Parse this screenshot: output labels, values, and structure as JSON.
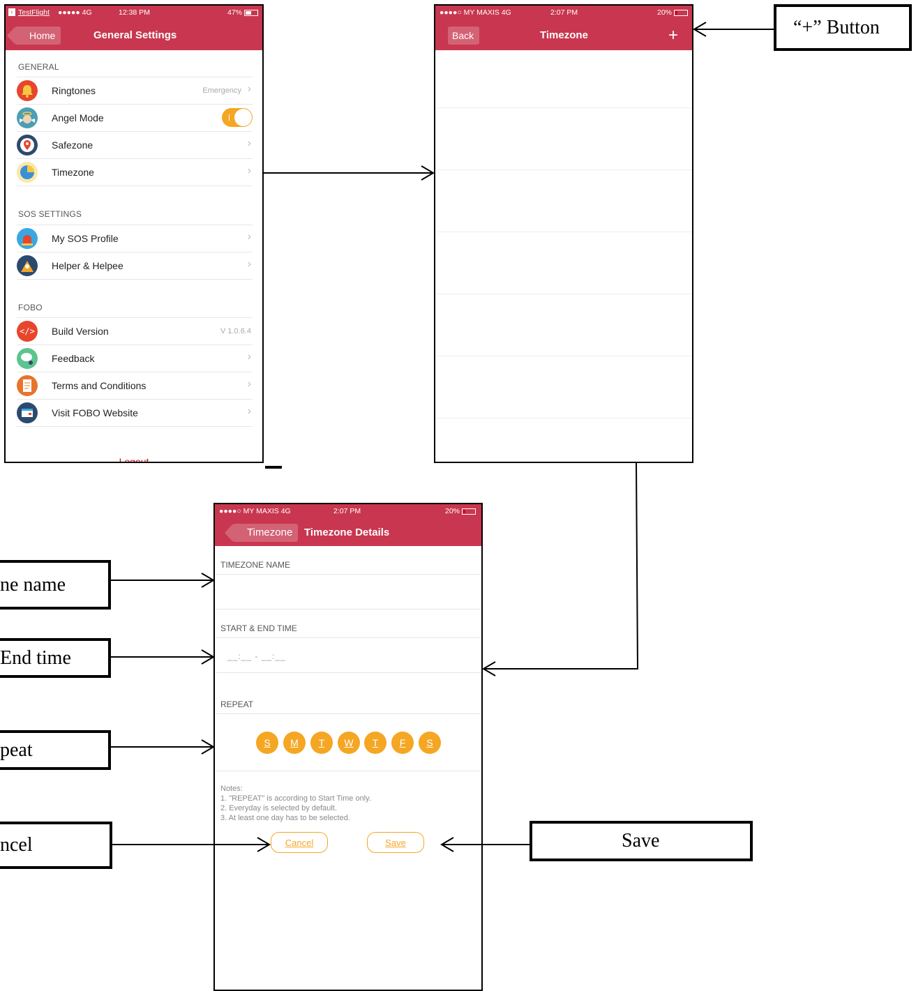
{
  "screen1": {
    "status": {
      "carrier": "TestFlight",
      "signal": "●●●●● 4G",
      "time": "12:38 PM",
      "battery": "47%"
    },
    "nav": {
      "back": "Home",
      "title": "General Settings"
    },
    "sections": [
      {
        "header": "GENERAL",
        "rows": [
          {
            "label": "Ringtones",
            "value": "Emergency",
            "icon": "bell-icon",
            "color": "#e8452c"
          },
          {
            "label": "Angel Mode",
            "toggle": true,
            "icon": "angel-icon",
            "color": "#4a9fb5"
          },
          {
            "label": "Safezone",
            "icon": "map-pin-icon",
            "color": "#2c4a6e"
          },
          {
            "label": "Timezone",
            "icon": "clock-icon",
            "color": "#f5c842"
          }
        ]
      },
      {
        "header": "SOS SETTINGS",
        "rows": [
          {
            "label": "My SOS Profile",
            "icon": "siren-icon",
            "color": "#3aa7e0"
          },
          {
            "label": "Helper & Helpee",
            "icon": "people-icon",
            "color": "#2c4a6e"
          }
        ]
      },
      {
        "header": "FOBO",
        "rows": [
          {
            "label": "Build Version",
            "value": "V 1.0.6.4",
            "icon": "code-icon",
            "color": "#e8452c"
          },
          {
            "label": "Feedback",
            "icon": "chat-icon",
            "color": "#5dc48f"
          },
          {
            "label": "Terms and Conditions",
            "icon": "document-icon",
            "color": "#e8742c"
          },
          {
            "label": "Visit FOBO Website",
            "icon": "browser-icon",
            "color": "#2c4a6e"
          }
        ]
      }
    ],
    "logout": "Logout"
  },
  "screen2": {
    "status": {
      "carrier": "●●●●○ MY MAXIS  4G",
      "time": "2:07 PM",
      "battery": "20%"
    },
    "nav": {
      "back": "Back",
      "title": "Timezone",
      "add": "+"
    }
  },
  "screen3": {
    "status": {
      "carrier": "●●●●○ MY MAXIS  4G",
      "time": "2:07 PM",
      "battery": "20%"
    },
    "nav": {
      "back": "Timezone",
      "title": "Timezone Details"
    },
    "name_header": "TIMEZONE NAME",
    "time_header": "START & END TIME",
    "time_placeholder": "__:__ - __:__",
    "repeat_header": "REPEAT",
    "days": [
      "S",
      "M",
      "T",
      "W",
      "T",
      "F",
      "S"
    ],
    "notes": [
      "Notes:",
      "1. \"REPEAT\" is according to Start Time only.",
      "2. Everyday is selected by default.",
      "3. At least one day has to be selected."
    ],
    "cancel": "Cancel",
    "save": "Save"
  },
  "callouts": {
    "plus": "“+” Button",
    "name": "ne name",
    "time": "End time",
    "repeat": "peat",
    "cancel": "ncel",
    "save": "Save"
  },
  "colors": {
    "accent": "#c8374f",
    "orange": "#f5a623"
  }
}
